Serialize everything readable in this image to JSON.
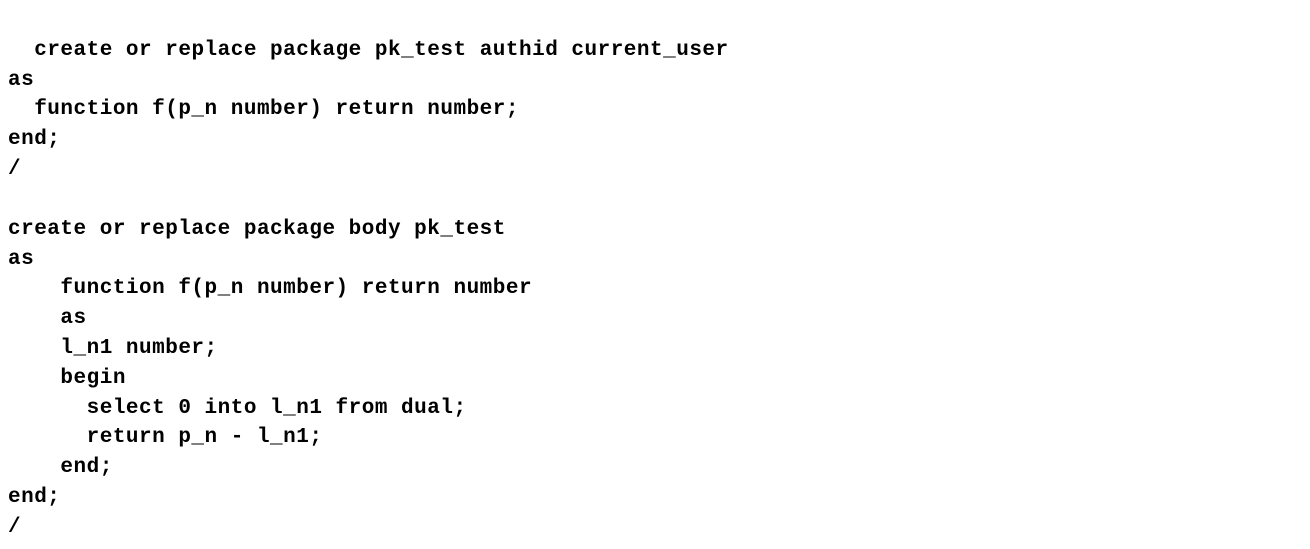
{
  "code": {
    "lines": [
      "create or replace package pk_test authid current_user",
      "as",
      "  function f(p_n number) return number;",
      "end;",
      "/",
      "",
      "create or replace package body pk_test",
      "as",
      "    function f(p_n number) return number",
      "    as",
      "    l_n1 number;",
      "    begin",
      "      select 0 into l_n1 from dual;",
      "      return p_n - l_n1;",
      "    end;",
      "end;",
      "/"
    ]
  }
}
